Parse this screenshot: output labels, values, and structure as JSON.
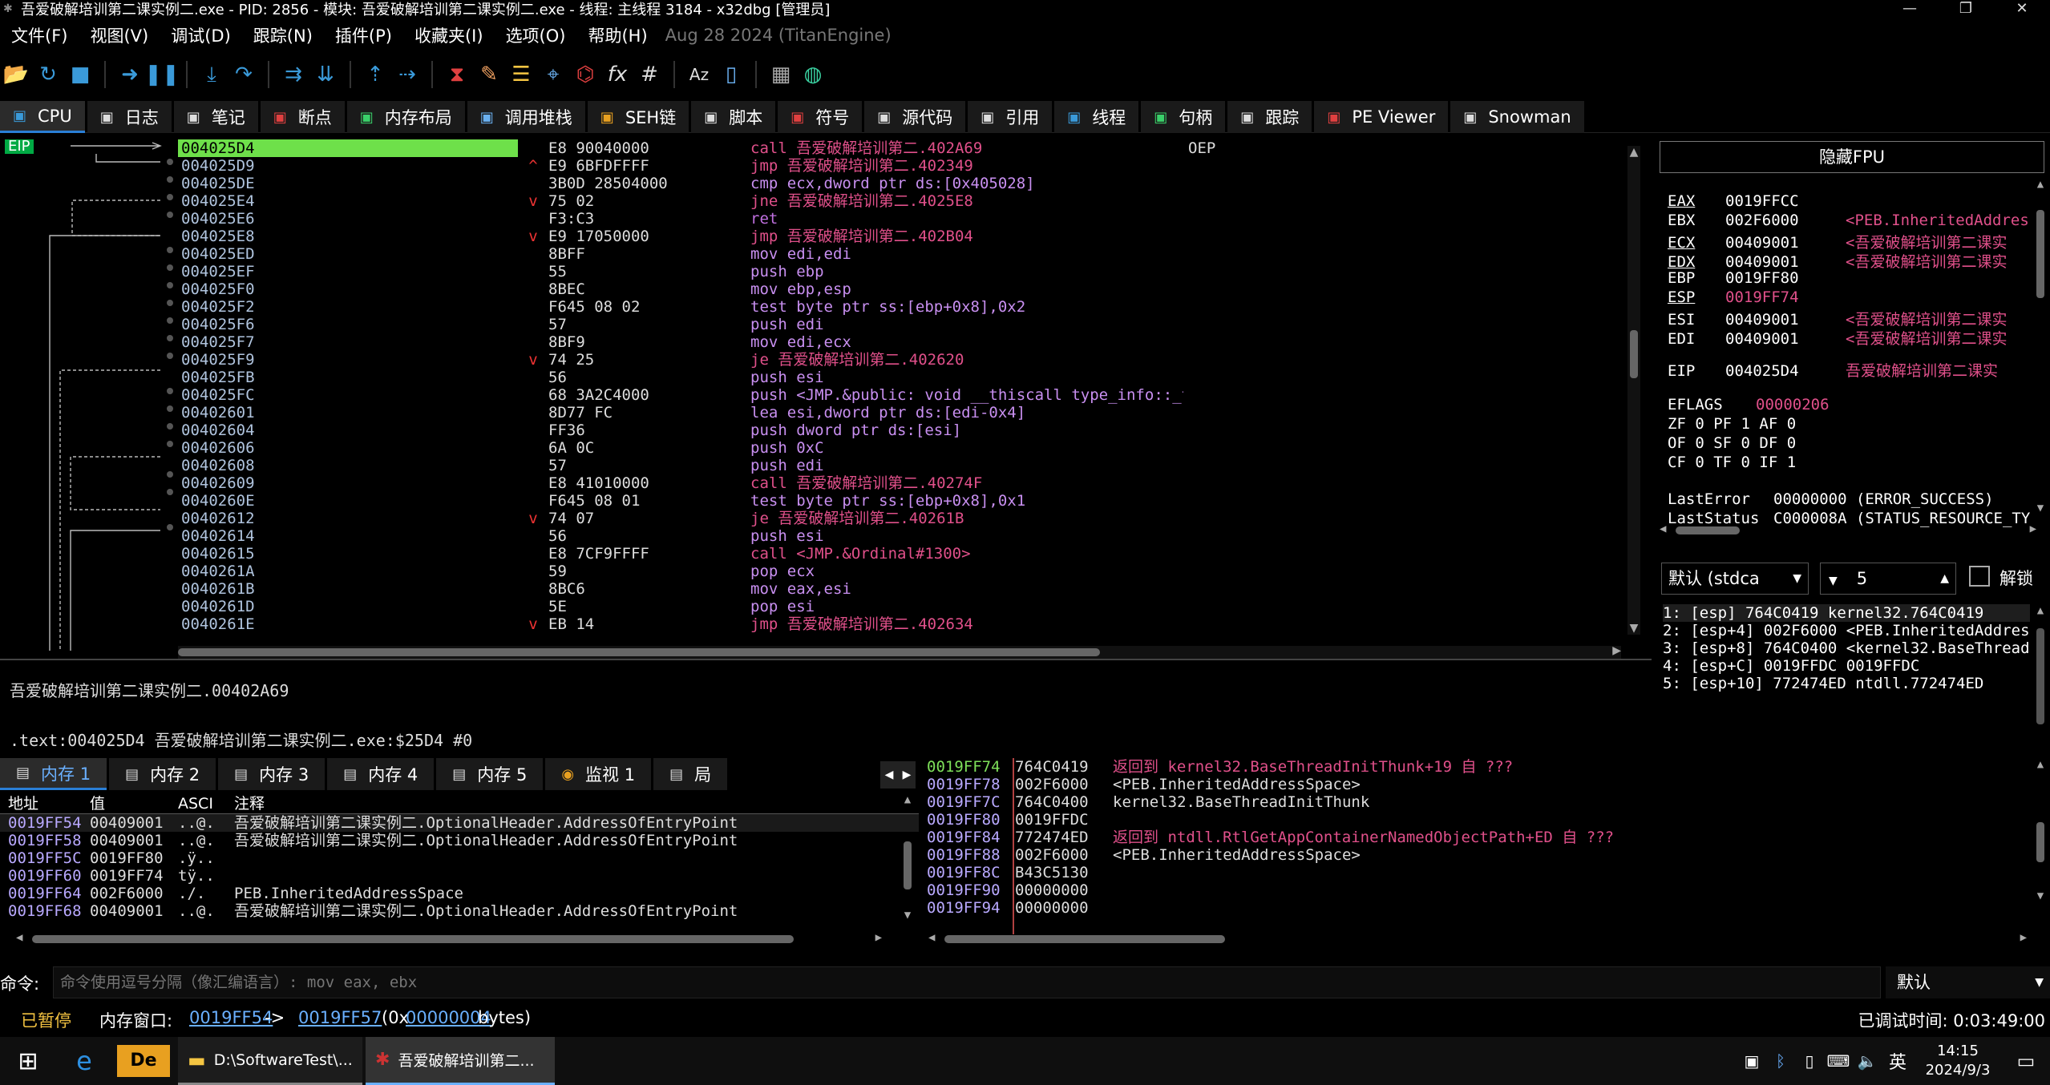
{
  "window": {
    "title": "吾爱破解培训第二课实例二.exe - PID: 2856 - 模块: 吾爱破解培训第二课实例二.exe - 线程: 主线程 3184 - x32dbg [管理员]"
  },
  "menu": {
    "items": [
      "文件(F)",
      "视图(V)",
      "调试(D)",
      "跟踪(N)",
      "插件(P)",
      "收藏夹(I)",
      "选项(O)",
      "帮助(H)"
    ],
    "build_date": "Aug 28 2024 (TitanEngine)"
  },
  "tabs": [
    {
      "label": "CPU",
      "icon": "cpu-icon"
    },
    {
      "label": "日志",
      "icon": "log-icon"
    },
    {
      "label": "笔记",
      "icon": "notes-icon"
    },
    {
      "label": "断点",
      "icon": "breakpoint-icon"
    },
    {
      "label": "内存布局",
      "icon": "memory-map-icon"
    },
    {
      "label": "调用堆栈",
      "icon": "callstack-icon"
    },
    {
      "label": "SEH链",
      "icon": "seh-icon"
    },
    {
      "label": "脚本",
      "icon": "script-icon"
    },
    {
      "label": "符号",
      "icon": "symbols-icon"
    },
    {
      "label": "源代码",
      "icon": "source-icon"
    },
    {
      "label": "引用",
      "icon": "references-icon"
    },
    {
      "label": "线程",
      "icon": "threads-icon"
    },
    {
      "label": "句柄",
      "icon": "handles-icon"
    },
    {
      "label": "跟踪",
      "icon": "trace-icon"
    },
    {
      "label": "PE Viewer",
      "icon": "pe-icon"
    },
    {
      "label": "Snowman",
      "icon": "snowman-icon"
    }
  ],
  "eip_label": "EIP",
  "disasm": [
    {
      "addr": "004025D4",
      "arrow": "",
      "bytes": "E8 90040000",
      "instr": "call 吾爱破解培训第二.402A69",
      "cls": "kw-call",
      "comment": "OEP",
      "cur": true
    },
    {
      "addr": "004025D9",
      "arrow": "^",
      "bytes": "E9 6BFDFFFF",
      "instr": "jmp 吾爱破解培训第二.402349",
      "cls": "kw-jmp",
      "comment": ""
    },
    {
      "addr": "004025DE",
      "arrow": "",
      "bytes": "3B0D 28504000",
      "instr": "cmp ecx,dword ptr  ds:[0x405028]",
      "cls": "ins",
      "comment": ""
    },
    {
      "addr": "004025E4",
      "arrow": "v",
      "bytes": "75 02",
      "instr": "jne 吾爱破解培训第二.4025E8",
      "cls": "kw-j",
      "comment": ""
    },
    {
      "addr": "004025E6",
      "arrow": "",
      "bytes": "F3:C3",
      "instr": "ret",
      "cls": "kw-ret",
      "comment": ""
    },
    {
      "addr": "004025E8",
      "arrow": "v",
      "bytes": "E9 17050000",
      "instr": "jmp 吾爱破解培训第二.402B04",
      "cls": "kw-jmp",
      "comment": ""
    },
    {
      "addr": "004025ED",
      "arrow": "",
      "bytes": "8BFF",
      "instr": "mov edi,edi",
      "cls": "ins",
      "comment": ""
    },
    {
      "addr": "004025EF",
      "arrow": "",
      "bytes": "55",
      "instr": "push ebp",
      "cls": "ins",
      "comment": ""
    },
    {
      "addr": "004025F0",
      "arrow": "",
      "bytes": "8BEC",
      "instr": "mov ebp,esp",
      "cls": "ins",
      "comment": ""
    },
    {
      "addr": "004025F2",
      "arrow": "",
      "bytes": "F645 08 02",
      "instr": "test byte ptr  ss:[ebp+0x8],0x2",
      "cls": "ins",
      "comment": ""
    },
    {
      "addr": "004025F6",
      "arrow": "",
      "bytes": "57",
      "instr": "push edi",
      "cls": "ins",
      "comment": ""
    },
    {
      "addr": "004025F7",
      "arrow": "",
      "bytes": "8BF9",
      "instr": "mov edi,ecx",
      "cls": "ins",
      "comment": ""
    },
    {
      "addr": "004025F9",
      "arrow": "v",
      "bytes": "74 25",
      "instr": "je 吾爱破解培训第二.402620",
      "cls": "kw-j",
      "comment": ""
    },
    {
      "addr": "004025FB",
      "arrow": "",
      "bytes": "56",
      "instr": "push esi",
      "cls": "ins",
      "comment": ""
    },
    {
      "addr": "004025FC",
      "arrow": "",
      "bytes": "68 3A2C4000",
      "instr": "push <JMP.&public: void __thiscall type_info::_ty",
      "cls": "ins",
      "comment": ""
    },
    {
      "addr": "00402601",
      "arrow": "",
      "bytes": "8D77 FC",
      "instr": "lea esi,dword ptr  ds:[edi-0x4]",
      "cls": "ins",
      "comment": ""
    },
    {
      "addr": "00402604",
      "arrow": "",
      "bytes": "FF36",
      "instr": "push dword ptr  ds:[esi]",
      "cls": "ins",
      "comment": ""
    },
    {
      "addr": "00402606",
      "arrow": "",
      "bytes": "6A 0C",
      "instr": "push 0xC",
      "cls": "ins",
      "comment": ""
    },
    {
      "addr": "00402608",
      "arrow": "",
      "bytes": "57",
      "instr": "push edi",
      "cls": "ins",
      "comment": ""
    },
    {
      "addr": "00402609",
      "arrow": "",
      "bytes": "E8 41010000",
      "instr": "call 吾爱破解培训第二.40274F",
      "cls": "kw-call",
      "comment": ""
    },
    {
      "addr": "0040260E",
      "arrow": "",
      "bytes": "F645 08 01",
      "instr": "test byte ptr  ss:[ebp+0x8],0x1",
      "cls": "ins",
      "comment": ""
    },
    {
      "addr": "00402612",
      "arrow": "v",
      "bytes": "74 07",
      "instr": "je 吾爱破解培训第二.40261B",
      "cls": "kw-j",
      "comment": ""
    },
    {
      "addr": "00402614",
      "arrow": "",
      "bytes": "56",
      "instr": "push esi",
      "cls": "ins",
      "comment": ""
    },
    {
      "addr": "00402615",
      "arrow": "",
      "bytes": "E8 7CF9FFFF",
      "instr": "call <JMP.&Ordinal#1300>",
      "cls": "kw-call",
      "comment": ""
    },
    {
      "addr": "0040261A",
      "arrow": "",
      "bytes": "59",
      "instr": "pop ecx",
      "cls": "ins",
      "comment": ""
    },
    {
      "addr": "0040261B",
      "arrow": "",
      "bytes": "8BC6",
      "instr": "mov eax,esi",
      "cls": "ins",
      "comment": ""
    },
    {
      "addr": "0040261D",
      "arrow": "",
      "bytes": "5E",
      "instr": "pop esi",
      "cls": "ins",
      "comment": ""
    },
    {
      "addr": "0040261E",
      "arrow": "v",
      "bytes": "EB 14",
      "instr": "jmp 吾爱破解培训第二.402634",
      "cls": "kw-jmp",
      "comment": ""
    }
  ],
  "info": {
    "line1": "吾爱破解培训第二课实例二.00402A69",
    "line2": ".text:004025D4 吾爱破解培训第二课实例二.exe:$25D4 #0"
  },
  "registers": {
    "header": "隐藏FPU",
    "rows": [
      {
        "n": "EAX",
        "v": "0019FFCC",
        "c": ""
      },
      {
        "n": "EBX",
        "v": "002F6000",
        "c": "<PEB.InheritedAddres"
      },
      {
        "n": "ECX",
        "v": "00409001",
        "c": "<吾爱破解培训第二课实"
      },
      {
        "n": "EDX",
        "v": "00409001",
        "c": "<吾爱破解培训第二课实"
      },
      {
        "n": "EBP",
        "v": "0019FF80",
        "c": ""
      },
      {
        "n": "ESP",
        "v": "0019FF74",
        "c": ""
      },
      {
        "n": "ESI",
        "v": "00409001",
        "c": "<吾爱破解培训第二课实"
      },
      {
        "n": "EDI",
        "v": "00409001",
        "c": "<吾爱破解培训第二课实"
      }
    ],
    "eip": {
      "n": "EIP",
      "v": "004025D4",
      "c": "吾爱破解培训第二课实"
    },
    "eflags": {
      "n": "EFLAGS",
      "v": "00000206"
    },
    "flags1": "ZF 0   PF 1   AF 0",
    "flags2": "OF 0   SF 0   DF 0",
    "flags3": "CF 0   TF 0   IF 1",
    "lasterror": {
      "n": "LastError",
      "v": "00000000 (ERROR_SUCCESS)"
    },
    "laststatus": {
      "n": "LastStatus",
      "v": "C000008A (STATUS_RESOURCE_TY"
    }
  },
  "stack_ctl": {
    "convention": "默认 (stdca",
    "count": "5",
    "unlock": "解锁"
  },
  "stack_args": [
    "1: [esp] 764C0419 kernel32.764C0419",
    "2: [esp+4] 002F6000 <PEB.InheritedAddres",
    "3: [esp+8] 764C0400 <kernel32.BaseThread",
    "4: [esp+C] 0019FFDC 0019FFDC",
    "5: [esp+10] 772474ED ntdll.772474ED"
  ],
  "mem_tabs": [
    "内存 1",
    "内存 2",
    "内存 3",
    "内存 4",
    "内存 5",
    "监视 1",
    "局"
  ],
  "mem_headers": {
    "addr": "地址",
    "val": "值",
    "ascii": "ASCI",
    "comment": "注释"
  },
  "mem_rows": [
    {
      "a": "0019FF54",
      "v": "00409001",
      "s": "..@.",
      "c": "吾爱破解培训第二课实例二.OptionalHeader.AddressOfEntryPoint"
    },
    {
      "a": "0019FF58",
      "v": "00409001",
      "s": "..@.",
      "c": "吾爱破解培训第二课实例二.OptionalHeader.AddressOfEntryPoint"
    },
    {
      "a": "0019FF5C",
      "v": "0019FF80",
      "s": ".ÿ..",
      "c": ""
    },
    {
      "a": "0019FF60",
      "v": "0019FF74",
      "s": "tÿ..",
      "c": ""
    },
    {
      "a": "0019FF64",
      "v": "002F6000",
      "s": "./.",
      "c": "PEB.InheritedAddressSpace"
    },
    {
      "a": "0019FF68",
      "v": "00409001",
      "s": "..@.",
      "c": "吾爱破解培训第二课实例二.OptionalHeader.AddressOfEntryPoint"
    }
  ],
  "stack_rows": [
    {
      "a": "0019FF74",
      "v": "764C0419",
      "c": "返回到 kernel32.BaseThreadInitThunk+19 自 ???",
      "hl": true
    },
    {
      "a": "0019FF78",
      "v": "002F6000",
      "c": "<PEB.InheritedAddressSpace>"
    },
    {
      "a": "0019FF7C",
      "v": "764C0400",
      "c": "kernel32.BaseThreadInitThunk"
    },
    {
      "a": "0019FF80",
      "v": "0019FFDC",
      "c": ""
    },
    {
      "a": "0019FF84",
      "v": "772474ED",
      "c": "返回到 ntdll.RtlGetAppContainerNamedObjectPath+ED 自 ???",
      "hl": true
    },
    {
      "a": "0019FF88",
      "v": "002F6000",
      "c": "<PEB.InheritedAddressSpace>"
    },
    {
      "a": "0019FF8C",
      "v": "B43C5130",
      "c": ""
    },
    {
      "a": "0019FF90",
      "v": "00000000",
      "c": ""
    },
    {
      "a": "0019FF94",
      "v": "00000000",
      "c": ""
    }
  ],
  "cmd": {
    "label": "命令:",
    "placeholder": "命令使用逗号分隔（像汇编语言）: mov eax, ebx",
    "mode": "默认"
  },
  "status": {
    "state": "已暂停",
    "memwin_label": "内存窗口:",
    "from": "0019FF54",
    "arrow": "->",
    "to": "0019FF57",
    "size_prefix": "(0x",
    "size": "00000004",
    "size_suffix": " bytes)",
    "time": "已调试时间:  0:03:49:00"
  },
  "taskbar": {
    "task1": "D:\\SoftwareTest\\...",
    "task2": "吾爱破解培训第二...",
    "ime": "英",
    "time": "14:15",
    "date": "2024/9/3"
  }
}
